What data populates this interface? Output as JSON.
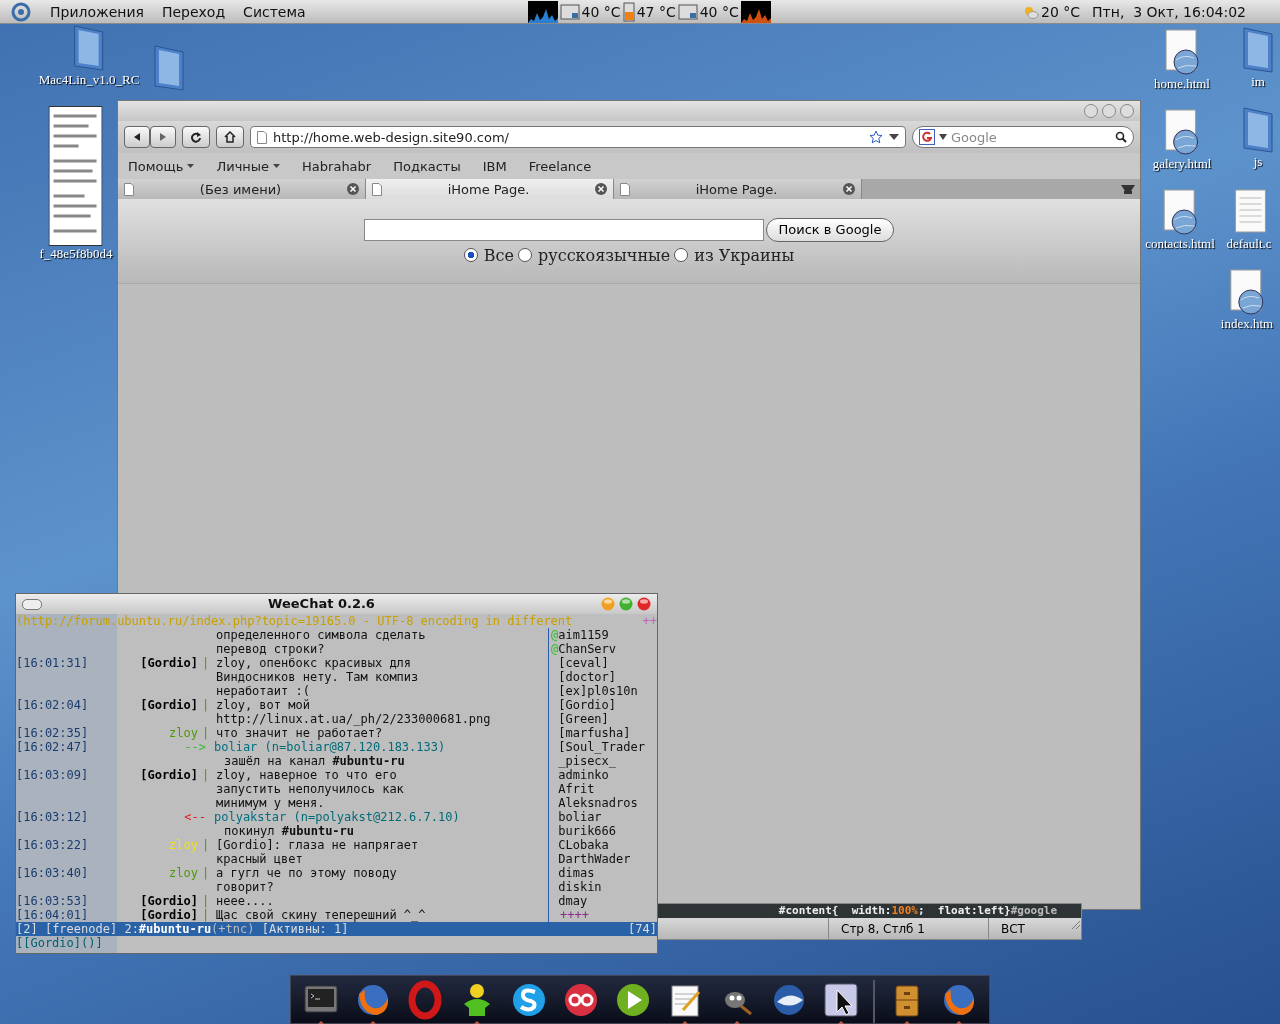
{
  "panel": {
    "menus": [
      "Приложения",
      "Переход",
      "Система"
    ],
    "sensors": [
      {
        "reading": "40 °C"
      },
      {
        "reading": "47 °C"
      },
      {
        "reading": "40 °C"
      }
    ],
    "weather": "20 °C",
    "clock": "Птн,  3 Окт, 16:04:02"
  },
  "desktop_icons": [
    {
      "kind": "folder",
      "label": "Mac4Lin_v1.0_RC"
    },
    {
      "kind": "folder"
    },
    {
      "kind": "thumbnail",
      "label": "f_48e5f8b0d4"
    },
    {
      "kind": "html",
      "label": "home.html"
    },
    {
      "kind": "folder",
      "label": "im"
    },
    {
      "kind": "html",
      "label": "galery.html"
    },
    {
      "kind": "folder",
      "label": "js"
    },
    {
      "kind": "html",
      "label": "contacts.html"
    },
    {
      "kind": "doc",
      "label": "default.c"
    },
    {
      "kind": "html",
      "label": "index.htm"
    }
  ],
  "browser": {
    "url": "http://home.web-design.site90.com/",
    "search_placeholder": "Google",
    "bookmarks": [
      {
        "label": "Помощь",
        "menu": true
      },
      {
        "label": "Личные",
        "menu": true
      },
      {
        "label": "Habrahabr",
        "menu": false
      },
      {
        "label": "Подкасты",
        "menu": false
      },
      {
        "label": "IBM",
        "menu": false
      },
      {
        "label": "Freelance",
        "menu": false
      }
    ],
    "tabs": [
      {
        "label": "(Без имени)",
        "selected": false
      },
      {
        "label": "iHome Page.",
        "selected": true
      },
      {
        "label": "iHome Page.",
        "selected": false
      }
    ],
    "page": {
      "search_button": "Поиск в Google",
      "radios": [
        {
          "label": "Все",
          "selected": true
        },
        {
          "label": "русскоязычные",
          "selected": false
        },
        {
          "label": "из Украины",
          "selected": false
        }
      ]
    }
  },
  "editor": {
    "code_parts": [
      "#content{",
      "  width:",
      "100%",
      ";  float:left}",
      "#google"
    ],
    "status": [
      "Стр 8, Стлб 1",
      "ВСТ"
    ]
  },
  "weechat": {
    "title": "WeeChat 0.2.6",
    "topic": "(http://forum.ubuntu.ru/index.php?topic=19165.0 - UTF-8 encoding in different",
    "topic_more": "++",
    "lines": [
      {
        "kind": "continuation",
        "text": "определенного символа сделать"
      },
      {
        "kind": "continuation",
        "text": "перевод строки?"
      },
      {
        "kind": "message",
        "time": "[16:01:31]",
        "nick": "[Gordio]",
        "color": "#000000",
        "separator": "|",
        "text": "zloy, опенбокс красивых для"
      },
      {
        "kind": "continuation",
        "text": "Виндосников нету. Там компиз"
      },
      {
        "kind": "continuation",
        "text": "неработаит :("
      },
      {
        "kind": "message",
        "time": "[16:02:04]",
        "nick": "[Gordio]",
        "color": "#000000",
        "separator": "|",
        "text": "zloy, вот мой"
      },
      {
        "kind": "continuation",
        "text": "http://linux.at.ua/_ph/2/233000681.png"
      },
      {
        "kind": "message",
        "time": "[16:02:35]",
        "nick": "zloy",
        "color": "#4c9a06",
        "separator": "|",
        "text": "что значит не работает?"
      },
      {
        "kind": "join",
        "time": "[16:02:47]",
        "arrow": "-->",
        "nick": "boliar",
        "host": "(n=boliar@87.120.183.133)"
      },
      {
        "kind": "event",
        "text": "зашёл на канал **#ubuntu-ru**"
      },
      {
        "kind": "message",
        "time": "[16:03:09]",
        "nick": "[Gordio]",
        "color": "#000000",
        "separator": "|",
        "text": "zloy, наверное то что его"
      },
      {
        "kind": "continuation",
        "text": "запустить неполучилось как"
      },
      {
        "kind": "continuation",
        "text": "минимум у меня."
      },
      {
        "kind": "part",
        "time": "[16:03:12]",
        "arrow": "<--",
        "nick": "polyakstar",
        "host": "(n=polyakst@212.6.7.10)"
      },
      {
        "kind": "event",
        "text": "покинул **#ubuntu-ru**"
      },
      {
        "kind": "message",
        "time": "[16:03:22]",
        "nick": "zloy",
        "color": "#f0e010",
        "separator": "|",
        "text": "[Gordio]: глаза не напрягает"
      },
      {
        "kind": "continuation",
        "text": "красный цвет"
      },
      {
        "kind": "message",
        "time": "[16:03:40]",
        "nick": "zloy",
        "color": "#4c9a06",
        "separator": "|",
        "text": "а гугл че по этому поводу"
      },
      {
        "kind": "continuation",
        "text": "говорит?"
      },
      {
        "kind": "message",
        "time": "[16:03:53]",
        "nick": "[Gordio]",
        "color": "#000000",
        "separator": "|",
        "text": "неее...."
      },
      {
        "kind": "message",
        "time": "[16:04:01]",
        "nick": "[Gordio]",
        "color": "#000000",
        "separator": "|",
        "text": "Щас свой скину теперешний ^_^"
      }
    ],
    "nicks": [
      {
        "prefix": "@",
        "name": "aim1159"
      },
      {
        "prefix": "@",
        "name": "ChanServ"
      },
      {
        "name": "[ceval]"
      },
      {
        "name": "[doctor]"
      },
      {
        "name": "[ex]pl0s10n"
      },
      {
        "name": "[Gordio]"
      },
      {
        "name": "[Green]"
      },
      {
        "name": "[marfusha]"
      },
      {
        "name": "[Soul_Trader"
      },
      {
        "name": "_pisecx_"
      },
      {
        "name": "adminko"
      },
      {
        "name": "Afrit"
      },
      {
        "name": "Aleksnadros"
      },
      {
        "name": "boliar"
      },
      {
        "name": "burik666"
      },
      {
        "name": "CLobaka"
      },
      {
        "name": "DarthWader"
      },
      {
        "name": "dimas"
      },
      {
        "name": "diskin"
      },
      {
        "name": "dmay"
      }
    ],
    "nicks_more": "++++",
    "status": {
      "window": "[2]",
      "server": "[freenode]",
      "channel_number": "2:",
      "channel": "#ubuntu-ru",
      "modes": "(+tnc)",
      "activity": "[Активны: 1]",
      "lines": "[74]"
    },
    "input": "[[Gordio]()]"
  },
  "dock": {
    "items": [
      {
        "kind": "terminal",
        "running": true
      },
      {
        "kind": "fox",
        "running": true
      },
      {
        "kind": "ring",
        "running": false
      },
      {
        "kind": "person",
        "running": true
      },
      {
        "kind": "wave",
        "running": false
      },
      {
        "kind": "disc",
        "running": false
      },
      {
        "kind": "play",
        "running": false
      },
      {
        "kind": "notepad",
        "running": true
      },
      {
        "kind": "mascot",
        "running": true
      },
      {
        "kind": "bird",
        "running": false
      },
      {
        "kind": "pointer",
        "running": true
      },
      {
        "kind": "cabinet",
        "running": true
      },
      {
        "kind": "fox",
        "running": true
      }
    ]
  }
}
